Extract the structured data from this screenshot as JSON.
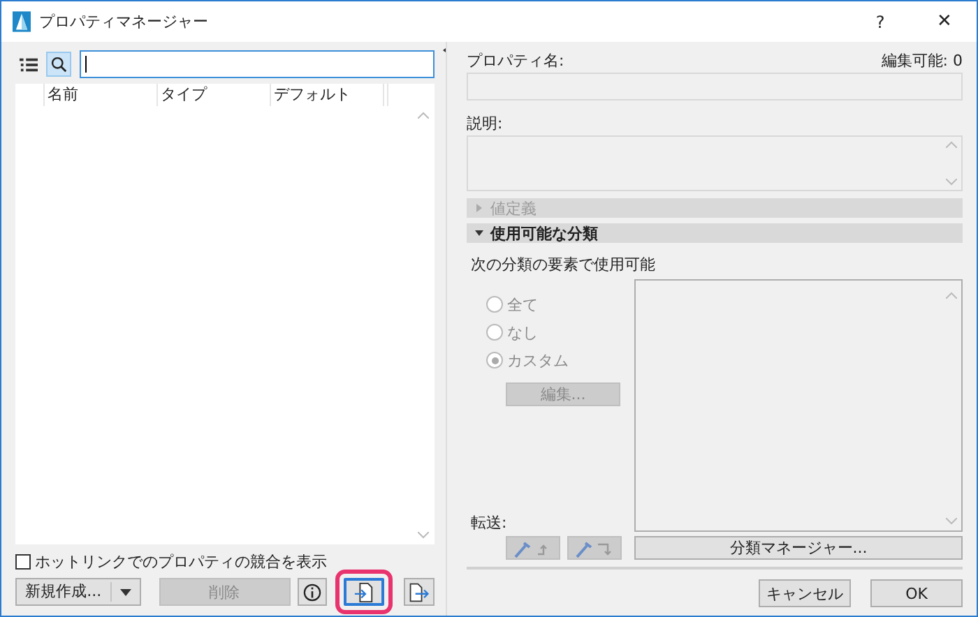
{
  "window": {
    "title": "プロパティマネージャー",
    "help": "?",
    "close": "✕"
  },
  "list": {
    "columns": [
      "名前",
      "タイプ",
      "デフォルト"
    ]
  },
  "hotlink_checkbox": {
    "label": "ホットリンクでのプロパティの競合を表示",
    "checked": false
  },
  "new_button": {
    "label": "新規作成..."
  },
  "delete_button": {
    "label": "削除",
    "disabled": true
  },
  "icon_buttons": [
    {
      "kind": "info",
      "highlighted": false
    },
    {
      "kind": "import",
      "highlighted": true
    },
    {
      "kind": "export",
      "highlighted": false
    }
  ],
  "property_name": {
    "label": "プロパティ名:",
    "editable_count": "編集可能: 0"
  },
  "description": {
    "label": "説明:"
  },
  "sections": [
    {
      "label": "値定義",
      "expanded": false,
      "disabled": true
    },
    {
      "label": "使用可能な分類",
      "expanded": true,
      "disabled": false
    }
  ],
  "availability_label": "次の分類の要素で使用可能",
  "radios": [
    {
      "label": "全て",
      "selected": false
    },
    {
      "label": "なし",
      "selected": false
    },
    {
      "label": "カスタム",
      "selected": true
    }
  ],
  "edit_button": {
    "label": "編集...",
    "disabled": true
  },
  "transfer_label": "転送:",
  "classification_manager_button": "分類マネージャー...",
  "cancel_button": "キャンセル",
  "ok_button": "OK"
}
